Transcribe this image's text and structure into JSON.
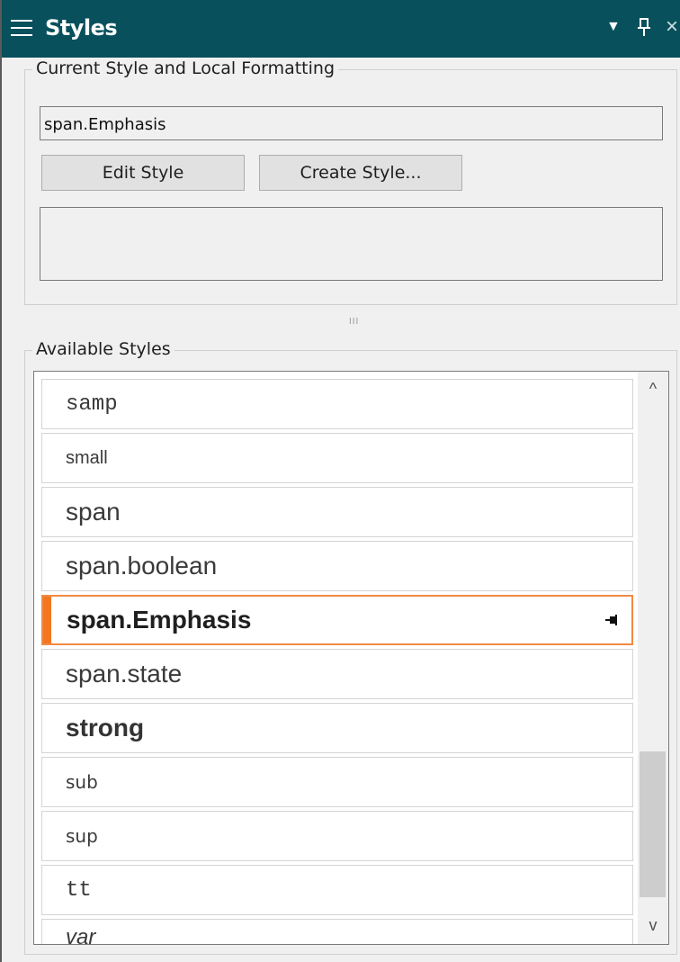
{
  "panel": {
    "title": "Styles",
    "dropdown_icon": "▼",
    "pin_icon": "ᆍ",
    "close_icon": "×"
  },
  "current_style": {
    "group_label": "Current Style and Local Formatting",
    "value": "span.Emphasis",
    "edit_label": "Edit Style",
    "create_label": "Create Style..."
  },
  "splitter_grip": "III",
  "available": {
    "group_label": "Available Styles",
    "items": [
      {
        "label": "samp"
      },
      {
        "label": "small"
      },
      {
        "label": "span"
      },
      {
        "label": "span.boolean"
      },
      {
        "label": "span.Emphasis"
      },
      {
        "label": "span.state"
      },
      {
        "label": "strong"
      },
      {
        "label": "sub"
      },
      {
        "label": "sup"
      },
      {
        "label": "tt"
      },
      {
        "label": "var"
      }
    ]
  },
  "scrollbar": {
    "up_arrow": "^",
    "down_arrow": "v"
  },
  "colors": {
    "titlebar": "#08505c",
    "selection_accent": "#f3771f"
  }
}
